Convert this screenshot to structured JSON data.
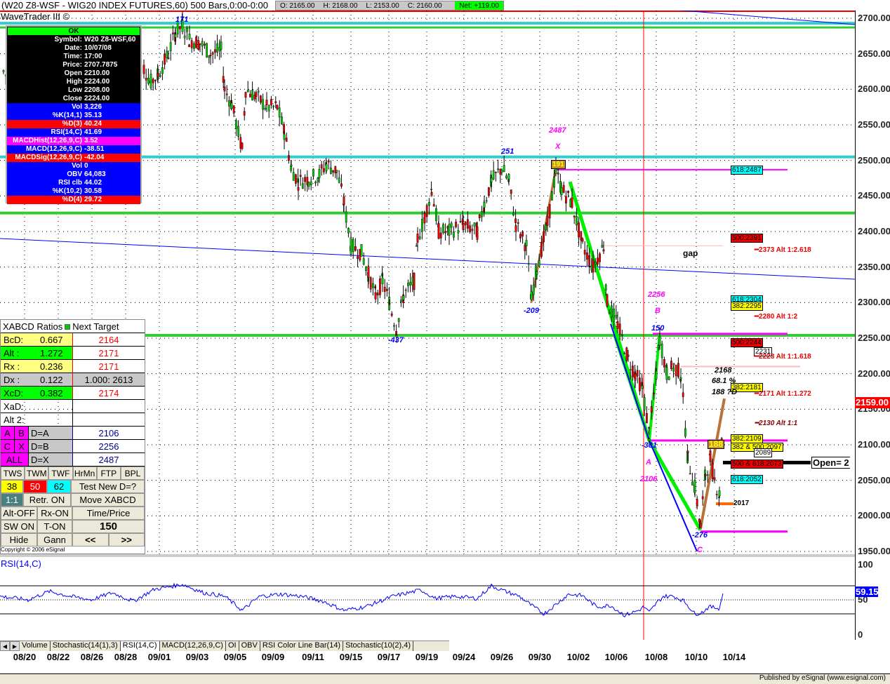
{
  "header": {
    "title": "(W20 Z8-WSF - WIG20 INDEX FUTURES,60) 500 Bars,0:00-0:00",
    "open": "O: 2165.00",
    "high": "H: 2168.00",
    "low": "L: 2153.00",
    "close": "C: 2160.00",
    "net": "Net: +119.00",
    "app": "WaveTrader III ©"
  },
  "info": {
    "ok": "OK",
    "rows": [
      {
        "k": "Symbol:",
        "v": "W20 Z8-WSF,60",
        "c": "black"
      },
      {
        "k": "Date:",
        "v": "10/07/08",
        "c": "black"
      },
      {
        "k": "Time:",
        "v": "17:00",
        "c": "black"
      },
      {
        "k": "Price:",
        "v": "2707.7875",
        "c": "black"
      },
      {
        "k": "Open",
        "v": "2210.00",
        "c": "black"
      },
      {
        "k": "High",
        "v": "2224.00",
        "c": "black"
      },
      {
        "k": "Low",
        "v": "2208.00",
        "c": "black"
      },
      {
        "k": "Close",
        "v": "2224.00",
        "c": "black"
      },
      {
        "k": "Vol",
        "v": "3,226",
        "c": "blue"
      },
      {
        "k": "%K(14,1)",
        "v": "35.13",
        "c": "blue"
      },
      {
        "k": "%D(3)",
        "v": "40.24",
        "c": "red"
      },
      {
        "k": "RSI(14,C)",
        "v": "41.69",
        "c": "blue"
      },
      {
        "k": "MACDHist(12,26,9,C)",
        "v": "3.52",
        "c": "mag"
      },
      {
        "k": "MACD(12,26,9,C)",
        "v": "-38.51",
        "c": "blue"
      },
      {
        "k": "MACDSig(12,26,9,C)",
        "v": "-42.04",
        "c": "red"
      },
      {
        "k": "Vol",
        "v": "0",
        "c": "blue"
      },
      {
        "k": "OBV",
        "v": "64,083",
        "c": "blue"
      },
      {
        "k": "RSI clb",
        "v": "44.02",
        "c": "blue"
      },
      {
        "k": "%K(10,2)",
        "v": "30.58",
        "c": "blue"
      },
      {
        "k": "%D(4)",
        "v": "29.72",
        "c": "red"
      }
    ]
  },
  "xabcd": {
    "head": "XABCD Ratios",
    "head2": "Next Target",
    "ratios": [
      {
        "n": "BcD:",
        "v": "0.667",
        "t": "2164",
        "c": "yel"
      },
      {
        "n": "Alt  :",
        "v": "1.272",
        "t": "2171",
        "c": "grn"
      },
      {
        "n": "Rx  :",
        "v": "0.236",
        "t": "2171",
        "c": "yel"
      },
      {
        "n": "Dx  :",
        "v": "0.122",
        "t": "1.000: 2613",
        "c": "gry"
      },
      {
        "n": "XcD:",
        "v": "0.382",
        "t": "2174",
        "c": "grn"
      },
      {
        "n": "XaD:",
        "v": "",
        "t": "",
        "c": ""
      },
      {
        "n": "Alt 2:",
        "v": "",
        "t": "",
        "c": ""
      }
    ],
    "pts": [
      {
        "a": "A",
        "b": "B",
        "d": "D=A",
        "v": "2106"
      },
      {
        "a": "C",
        "b": "X",
        "d": "D=B",
        "v": "2256"
      },
      {
        "a": "ALL",
        "b": "",
        "d": "D=X",
        "v": "2487"
      }
    ],
    "buttons": {
      "row1": [
        "TWS",
        "TWM",
        "TWF",
        "HrMn",
        "FTP",
        "BPL"
      ],
      "fib": [
        "38",
        "50",
        "62"
      ],
      "test": "Test New D=?",
      "one": "1:1",
      "retr": "Retr. ON",
      "move": "Move XABCD",
      "altoff": "Alt-OFF",
      "rxon": "Rx-ON",
      "tp": "Time/Price",
      "sw": "SW ON",
      "ton": "T-ON",
      "num": "150",
      "hide": "Hide",
      "gann": "Gann",
      "prev": "<<",
      "next": ">>"
    },
    "copyright": "Copyright © 2006 eSignal"
  },
  "axis": {
    "price_ticks": [
      "2700.00",
      "2650.00",
      "2600.00",
      "2550.00",
      "2500.00",
      "2450.00",
      "2400.00",
      "2350.00",
      "2300.00",
      "2250.00",
      "2200.00",
      "2150.00",
      "2100.00",
      "2050.00",
      "2000.00",
      "1950.00"
    ],
    "last": "2159.00",
    "rsi_ticks": [
      "100",
      "50",
      "0"
    ],
    "rsi_last": "59.15"
  },
  "levels": [
    {
      "t": "618:2487",
      "p": 2487,
      "bg": "#0ff"
    },
    {
      "t": "500:2391",
      "p": 2391,
      "bg": "#e00"
    },
    {
      "t": "618:2304",
      "p": 2304,
      "bg": "#0ff"
    },
    {
      "t": "382:2295",
      "p": 2295,
      "bg": "#ff0"
    },
    {
      "t": "500:2244",
      "p": 2244,
      "bg": "#e00"
    },
    {
      "t": "2231",
      "p": 2231,
      "bg": "#fff"
    },
    {
      "t": "382:2181",
      "p": 2181,
      "bg": "#ff0"
    },
    {
      "t": "382:2109",
      "p": 2109,
      "bg": "#ff0"
    },
    {
      "t": "382 & 500:2097",
      "p": 2097,
      "bg": "#ff0"
    },
    {
      "t": "2089",
      "p": 2089,
      "bg": "#fff"
    },
    {
      "t": "500 & 618:2073",
      "p": 2073,
      "bg": "#e00"
    },
    {
      "t": "618:2052",
      "p": 2052,
      "bg": "#0ff"
    }
  ],
  "alts": [
    {
      "t": "2373 Alt 1:2.618",
      "p": 2373
    },
    {
      "t": "2280 Alt 1:2",
      "p": 2280
    },
    {
      "t": "2223 Alt 1:1.618",
      "p": 2223
    },
    {
      "t": "2171 Alt 1:1.272",
      "p": 2171
    },
    {
      "t": "2130 Alt 1:1",
      "p": 2130
    }
  ],
  "annotations": {
    "a171": "171",
    "a251": "251",
    "a437": "-437",
    "a209": "-209",
    "x2487": "2487",
    "x": "X",
    "b2256": "2256",
    "b": "B",
    "b150": "150",
    "a381": "-381",
    "a": "A",
    "a2106": "2106",
    "c276": "-276",
    "c": "C",
    "d2168": "2168",
    "d681": "68.1 %",
    "d188": "188 ?D",
    "box191": "191",
    "box188": "188",
    "gap": "gap",
    "o2017": "2017",
    "open": "Open= 2"
  },
  "rsi_title": "RSI(14,C)",
  "tabs": [
    "Volume",
    "Stochastic(14(1),3)",
    "RSI(14,C)",
    "MACD(12,26,9,C)",
    "OI",
    "OBV",
    "RSI Color Line Bar(14)",
    "Stochastic(10(2),4)"
  ],
  "dates": [
    "08/20",
    "08/22",
    "08/26",
    "08/28",
    "09/01",
    "09/03",
    "09/05",
    "09/09",
    "09/11",
    "09/15",
    "09/17",
    "09/19",
    "09/24",
    "09/26",
    "09/30",
    "10/02",
    "10/06",
    "10/08",
    "10/10",
    "10/14"
  ],
  "status": "Published by eSignal (www.esignal.com)",
  "chart_data": {
    "type": "candlestick",
    "title": "W20 Z8-WSF - WIG20 INDEX FUTURES,60",
    "ylim": [
      1950,
      2700
    ],
    "swing_closes": [
      [
        5,
        2625
      ],
      [
        15,
        2610
      ],
      [
        205,
        2630
      ],
      [
        215,
        2610
      ],
      [
        225,
        2620
      ],
      [
        240,
        2650
      ],
      [
        250,
        2680
      ],
      [
        260,
        2690
      ],
      [
        270,
        2670
      ],
      [
        285,
        2665
      ],
      [
        300,
        2650
      ],
      [
        315,
        2655
      ],
      [
        320,
        2600
      ],
      [
        330,
        2580
      ],
      [
        345,
        2515
      ],
      [
        350,
        2600
      ],
      [
        365,
        2590
      ],
      [
        380,
        2575
      ],
      [
        395,
        2575
      ],
      [
        405,
        2540
      ],
      [
        415,
        2490
      ],
      [
        425,
        2470
      ],
      [
        440,
        2475
      ],
      [
        455,
        2480
      ],
      [
        465,
        2495
      ],
      [
        480,
        2485
      ],
      [
        490,
        2440
      ],
      [
        500,
        2380
      ],
      [
        515,
        2370
      ],
      [
        525,
        2340
      ],
      [
        535,
        2310
      ],
      [
        545,
        2330
      ],
      [
        555,
        2300
      ],
      [
        565,
        2262
      ],
      [
        575,
        2310
      ],
      [
        590,
        2330
      ],
      [
        595,
        2390
      ],
      [
        605,
        2420
      ],
      [
        615,
        2460
      ],
      [
        625,
        2400
      ],
      [
        640,
        2400
      ],
      [
        660,
        2410
      ],
      [
        680,
        2400
      ],
      [
        690,
        2440
      ],
      [
        700,
        2470
      ],
      [
        715,
        2490
      ],
      [
        725,
        2470
      ],
      [
        735,
        2410
      ],
      [
        750,
        2380
      ],
      [
        757,
        2305
      ],
      [
        765,
        2350
      ],
      [
        780,
        2410
      ],
      [
        792,
        2485
      ],
      [
        800,
        2460
      ],
      [
        815,
        2440
      ],
      [
        830,
        2380
      ],
      [
        845,
        2350
      ],
      [
        860,
        2380
      ],
      [
        865,
        2300
      ],
      [
        880,
        2270
      ],
      [
        895,
        2220
      ],
      [
        905,
        2200
      ],
      [
        915,
        2180
      ],
      [
        925,
        2115
      ],
      [
        935,
        2200
      ],
      [
        940,
        2250
      ],
      [
        950,
        2200
      ],
      [
        960,
        2210
      ],
      [
        970,
        2200
      ],
      [
        980,
        2080
      ],
      [
        990,
        2040
      ],
      [
        998,
        1985
      ],
      [
        1005,
        2060
      ],
      [
        1012,
        2080
      ],
      [
        1018,
        2050
      ],
      [
        1025,
        2030
      ],
      [
        1030,
        2160
      ]
    ],
    "rsi": [
      [
        0,
        55
      ],
      [
        40,
        50
      ],
      [
        70,
        62
      ],
      [
        100,
        55
      ],
      [
        130,
        50
      ],
      [
        160,
        60
      ],
      [
        190,
        48
      ],
      [
        220,
        65
      ],
      [
        260,
        72
      ],
      [
        290,
        60
      ],
      [
        320,
        55
      ],
      [
        345,
        35
      ],
      [
        370,
        55
      ],
      [
        400,
        58
      ],
      [
        430,
        55
      ],
      [
        460,
        48
      ],
      [
        490,
        35
      ],
      [
        520,
        40
      ],
      [
        560,
        55
      ],
      [
        600,
        64
      ],
      [
        620,
        52
      ],
      [
        650,
        55
      ],
      [
        680,
        52
      ],
      [
        700,
        70
      ],
      [
        720,
        62
      ],
      [
        740,
        55
      ],
      [
        760,
        40
      ],
      [
        775,
        30
      ],
      [
        790,
        42
      ],
      [
        810,
        58
      ],
      [
        830,
        56
      ],
      [
        850,
        40
      ],
      [
        870,
        42
      ],
      [
        890,
        28
      ],
      [
        910,
        35
      ],
      [
        917,
        40
      ],
      [
        925,
        32
      ],
      [
        935,
        45
      ],
      [
        945,
        55
      ],
      [
        960,
        55
      ],
      [
        975,
        48
      ],
      [
        990,
        30
      ],
      [
        1000,
        32
      ],
      [
        1010,
        40
      ],
      [
        1025,
        38
      ],
      [
        1030,
        59
      ]
    ]
  }
}
